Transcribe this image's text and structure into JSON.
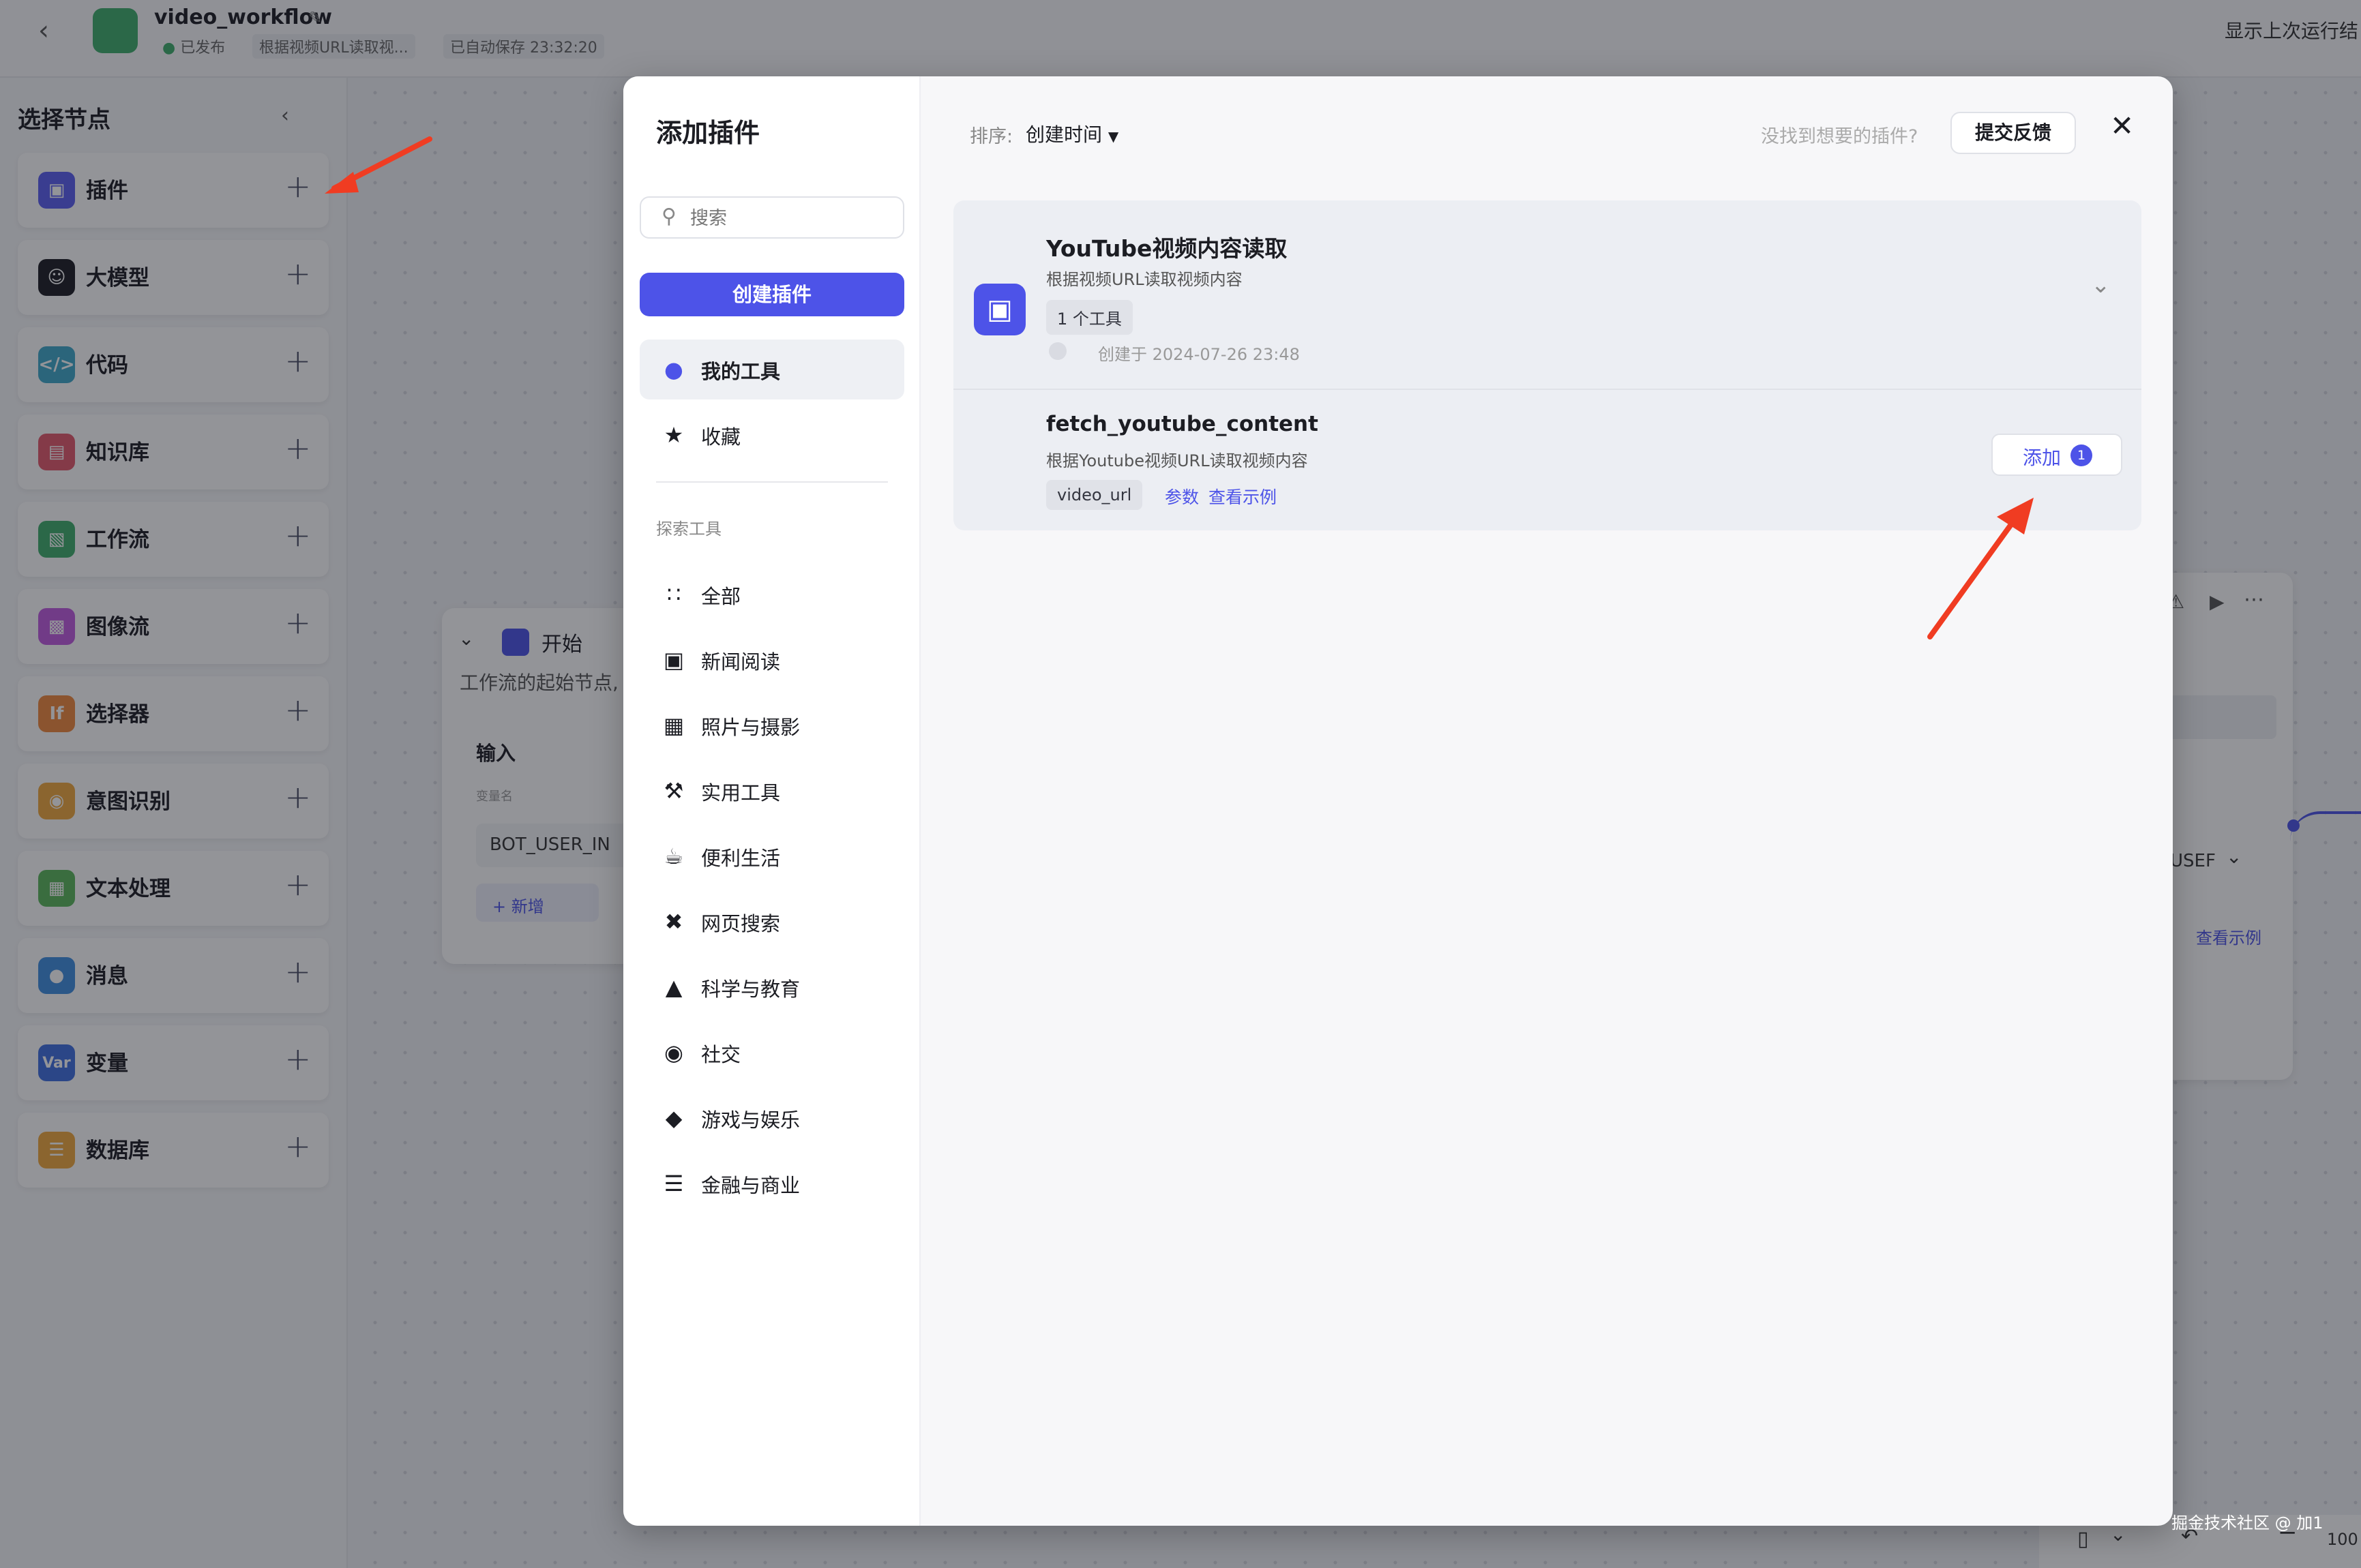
{
  "topbar": {
    "title": "video_workflow",
    "status_published": "已发布",
    "description": "根据视频URL读取视...",
    "autosave": "已自动保存 23:32:20",
    "show_last_run": "显示上次运行结"
  },
  "sidebar": {
    "title": "选择节点",
    "items": [
      {
        "label": "插件",
        "color": "#5b5ef0",
        "icon": "cube-icon"
      },
      {
        "label": "大模型",
        "color": "#1c1d23",
        "icon": "model-icon"
      },
      {
        "label": "代码",
        "color": "#3fa8c9",
        "icon": "code-icon"
      },
      {
        "label": "知识库",
        "color": "#e35a6b",
        "icon": "knowledge-icon"
      },
      {
        "label": "工作流",
        "color": "#3fae6b",
        "icon": "workflow-icon"
      },
      {
        "label": "图像流",
        "color": "#c05be0",
        "icon": "image-flow-icon"
      },
      {
        "label": "选择器",
        "color": "#f08a3e",
        "icon": "selector-icon"
      },
      {
        "label": "意图识别",
        "color": "#f0a93e",
        "icon": "intent-icon"
      },
      {
        "label": "文本处理",
        "color": "#5cb85c",
        "icon": "text-icon"
      },
      {
        "label": "消息",
        "color": "#3f8ee0",
        "icon": "message-icon"
      },
      {
        "label": "变量",
        "color": "#3f6fe0",
        "icon": "variable-icon",
        "badge": "Var"
      },
      {
        "label": "数据库",
        "color": "#f0a93e",
        "icon": "database-icon"
      }
    ]
  },
  "start_node": {
    "title": "开始",
    "description": "工作流的起始节点,",
    "input_label": "输入",
    "var_name_label": "变量名",
    "var_value": "BOT_USER_IN",
    "add_label": "+ 新增"
  },
  "right_node": {
    "field_value": "USEF",
    "link": "查看示例"
  },
  "modal": {
    "title": "添加插件",
    "search_placeholder": "搜索",
    "create_button": "创建插件",
    "nav": [
      {
        "label": "我的工具",
        "icon": "user-icon",
        "active": true
      },
      {
        "label": "收藏",
        "icon": "star-icon"
      }
    ],
    "explore_title": "探索工具",
    "categories": [
      {
        "label": "全部",
        "icon": "grid-icon"
      },
      {
        "label": "新闻阅读",
        "icon": "book-icon"
      },
      {
        "label": "照片与摄影",
        "icon": "photo-icon"
      },
      {
        "label": "实用工具",
        "icon": "wrench-icon"
      },
      {
        "label": "便利生活",
        "icon": "cup-icon"
      },
      {
        "label": "网页搜索",
        "icon": "network-icon"
      },
      {
        "label": "科学与教育",
        "icon": "graduation-cap-icon"
      },
      {
        "label": "社交",
        "icon": "chat-icon"
      },
      {
        "label": "游戏与娱乐",
        "icon": "gamepad-icon"
      },
      {
        "label": "金融与商业",
        "icon": "coins-icon"
      }
    ],
    "sort_label": "排序:",
    "sort_value": "创建时间",
    "feedback_question": "没找到想要的插件?",
    "feedback_button": "提交反馈",
    "plugin": {
      "name": "YouTube视频内容读取",
      "description": "根据视频URL读取视频内容",
      "tool_count": "1 个工具",
      "created": "创建于 2024-07-26 23:48"
    },
    "tool": {
      "name": "fetch_youtube_content",
      "description": "根据Youtube视频URL读取视频内容",
      "param_tag": "video_url",
      "params_link": "参数",
      "example_link": "查看示例",
      "add_button": "添加",
      "add_count": "1"
    }
  },
  "footer": {
    "watermark": "掘金技术社区 @ 加1",
    "zoom": "100"
  },
  "accent": "#4d53e8"
}
